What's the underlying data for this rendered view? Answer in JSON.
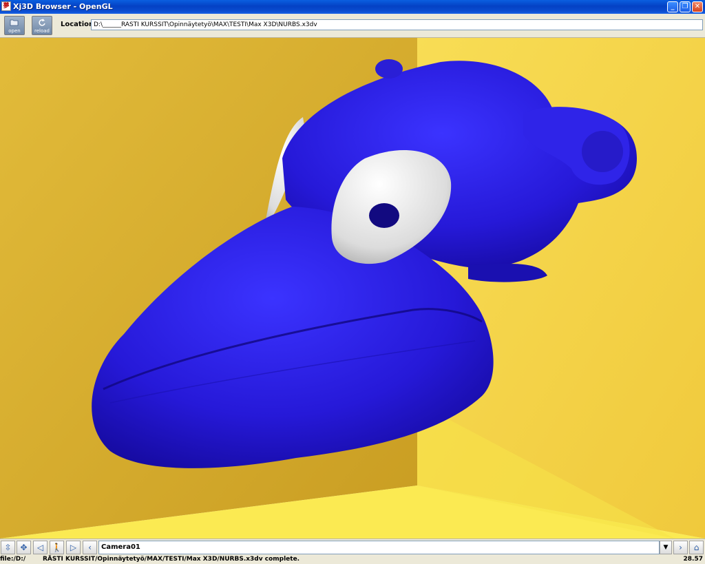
{
  "window": {
    "title": "Xj3D Browser - OpenGL",
    "app_icon_glyph": "夢"
  },
  "toolbar": {
    "open_label": "open",
    "reload_label": "reload",
    "location_label": "Location:",
    "location_value": "D:\\______RÄSTI KURSSIT\\Opinnäytetyö\\MAX\\TESTI\\Max X3D\\NURBS.x3dv"
  },
  "viewport": {
    "scene": "blue NURBS creature with white eyes on yellow background",
    "colors": {
      "body": "#2a1fd6",
      "eye": "#f2f2f2",
      "wall_left": "#d9b030",
      "wall_right": "#f3d448",
      "floor": "#fbea52"
    }
  },
  "navbar": {
    "buttons": [
      "pan-icon",
      "move-icon",
      "back-icon",
      "walk-icon",
      "forward-icon",
      "prev-viewpoint-icon"
    ],
    "viewpoint": "Camera01",
    "next_viewpoint_icon": "next-viewpoint-icon",
    "home_icon": "home-icon"
  },
  "status": {
    "left": "file:/D:/",
    "message": "RÄSTI KURSSIT/Opinnäytetyö/MAX/TESTI/Max X3D/NURBS.x3dv complete.",
    "fps": "28.57"
  }
}
